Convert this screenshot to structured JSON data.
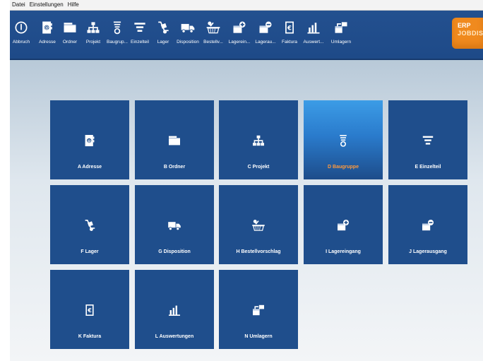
{
  "menu": [
    "Datei",
    "Einstellungen",
    "Hilfe"
  ],
  "toolbar": [
    {
      "label": "Abbruch",
      "icon": "power-icon"
    },
    {
      "label": "Adresse",
      "icon": "address-book-icon"
    },
    {
      "label": "Ordner",
      "icon": "folder-icon"
    },
    {
      "label": "Projekt",
      "icon": "hierarchy-icon"
    },
    {
      "label": "Baugrup...",
      "icon": "assembly-icon"
    },
    {
      "label": "Einzelteil",
      "icon": "part-icon"
    },
    {
      "label": "Lager",
      "icon": "hand-truck-icon"
    },
    {
      "label": "Disposition",
      "icon": "delivery-truck-icon"
    },
    {
      "label": "Bestellv...",
      "icon": "shopping-basket-icon"
    },
    {
      "label": "Lagerein...",
      "icon": "box-plus-icon"
    },
    {
      "label": "Lagerau...",
      "icon": "box-minus-icon"
    },
    {
      "label": "Faktura",
      "icon": "invoice-icon"
    },
    {
      "label": "Auswert...",
      "icon": "bar-chart-icon"
    },
    {
      "label": "Umlagern",
      "icon": "box-transfer-icon"
    }
  ],
  "logo": {
    "line1": "ERP",
    "line2": "JOBDIS"
  },
  "tiles": [
    {
      "label": "A Adresse",
      "icon": "address-book-icon"
    },
    {
      "label": "B Ordner",
      "icon": "folder-icon"
    },
    {
      "label": "C Projekt",
      "icon": "hierarchy-icon"
    },
    {
      "label": "D Baugruppe",
      "icon": "assembly-icon",
      "active": true
    },
    {
      "label": "E Einzelteil",
      "icon": "part-icon"
    },
    {
      "label": "F Lager",
      "icon": "hand-truck-icon"
    },
    {
      "label": "G Disposition",
      "icon": "delivery-truck-icon"
    },
    {
      "label": "H Bestellvorschlag",
      "icon": "shopping-basket-icon"
    },
    {
      "label": "I Lagereingang",
      "icon": "box-plus-icon"
    },
    {
      "label": "J Lagerausgang",
      "icon": "box-minus-icon"
    },
    {
      "label": "K Faktura",
      "icon": "invoice-icon"
    },
    {
      "label": "L Auswertungen",
      "icon": "bar-chart-icon"
    },
    {
      "label": "N Umlagern",
      "icon": "box-transfer-icon"
    }
  ],
  "colors": {
    "tile": "#1f4e8c",
    "toolbar": "#23508f",
    "accent": "#f08a1e",
    "active_label": "#ff9a3c"
  }
}
